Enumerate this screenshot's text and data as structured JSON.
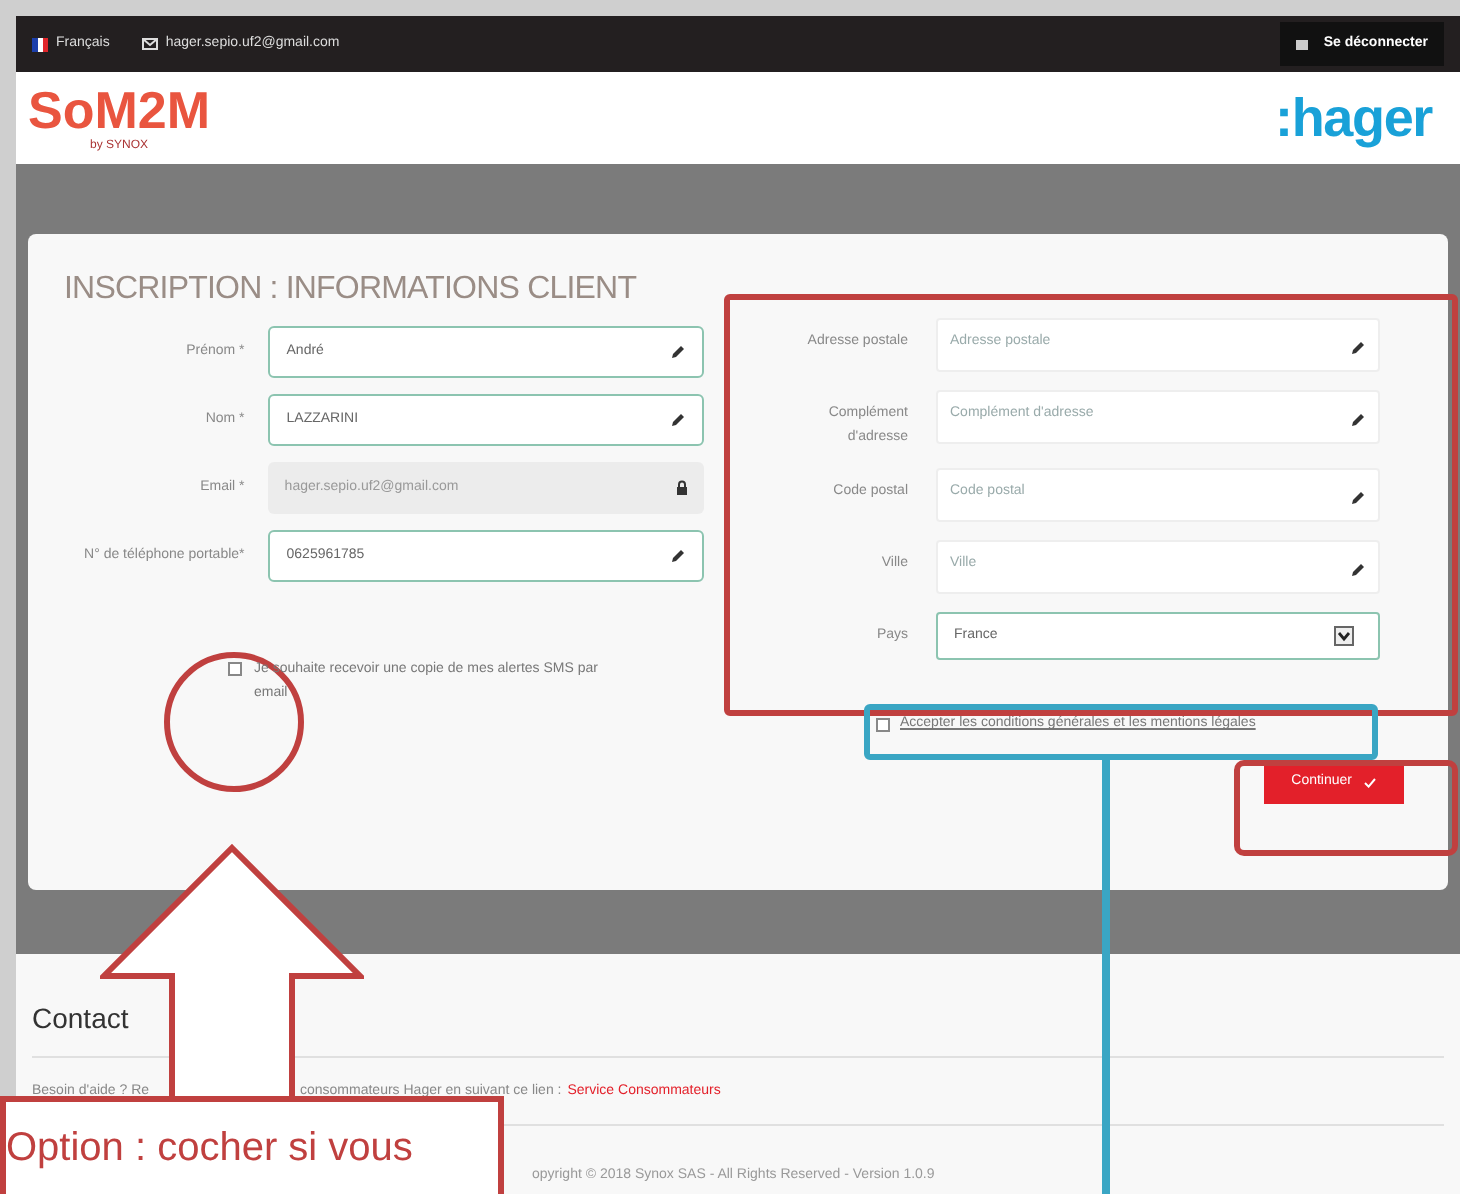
{
  "top_bar": {
    "language": "Français",
    "email": "hager.sepio.uf2@gmail.com",
    "logout": "Se déconnecter"
  },
  "header": {
    "logo": "SoM2M",
    "logo_sub": "by SYNOX",
    "brand": ":hager"
  },
  "form": {
    "title": "INSCRIPTION : INFORMATIONS CLIENT",
    "left_fields": [
      {
        "label": "Prénom *",
        "value": "André",
        "locked": false
      },
      {
        "label": "Nom *",
        "value": "LAZZARINI",
        "locked": false
      },
      {
        "label": "Email *",
        "value": "hager.sepio.uf2@gmail.com",
        "locked": true
      },
      {
        "label": "N° de téléphone portable*",
        "value": "0625961785",
        "locked": false
      }
    ],
    "right_fields": [
      {
        "kind": "text",
        "label": "Adresse postale",
        "placeholder": "Adresse postale"
      },
      {
        "kind": "text",
        "label": "Complément d'adresse",
        "placeholder": "Complément d'adresse"
      },
      {
        "kind": "text",
        "label": "Code postal",
        "placeholder": "Code postal"
      },
      {
        "kind": "text",
        "label": "Ville",
        "placeholder": "Ville"
      },
      {
        "kind": "select",
        "label": "Pays",
        "value": "France"
      }
    ],
    "sms_option": {
      "label": "Je souhaite recevoir une copie de mes alertes SMS par email",
      "checked": false
    },
    "terms": {
      "label": "Accepter les conditions générales et les mentions légales",
      "checked": false
    },
    "submit": "Continuer"
  },
  "contact": {
    "title": "Contact",
    "help_text_start": "Besoin d'aide ? Re",
    "help_text_end": "consommateurs Hager en suivant ce lien :",
    "link": "Service Consommateurs",
    "copyright": "opyright © 2018 Synox SAS - All Rights Reserved - Version 1.0.9"
  },
  "annotations": {
    "callout": "Option : cocher si vous"
  }
}
